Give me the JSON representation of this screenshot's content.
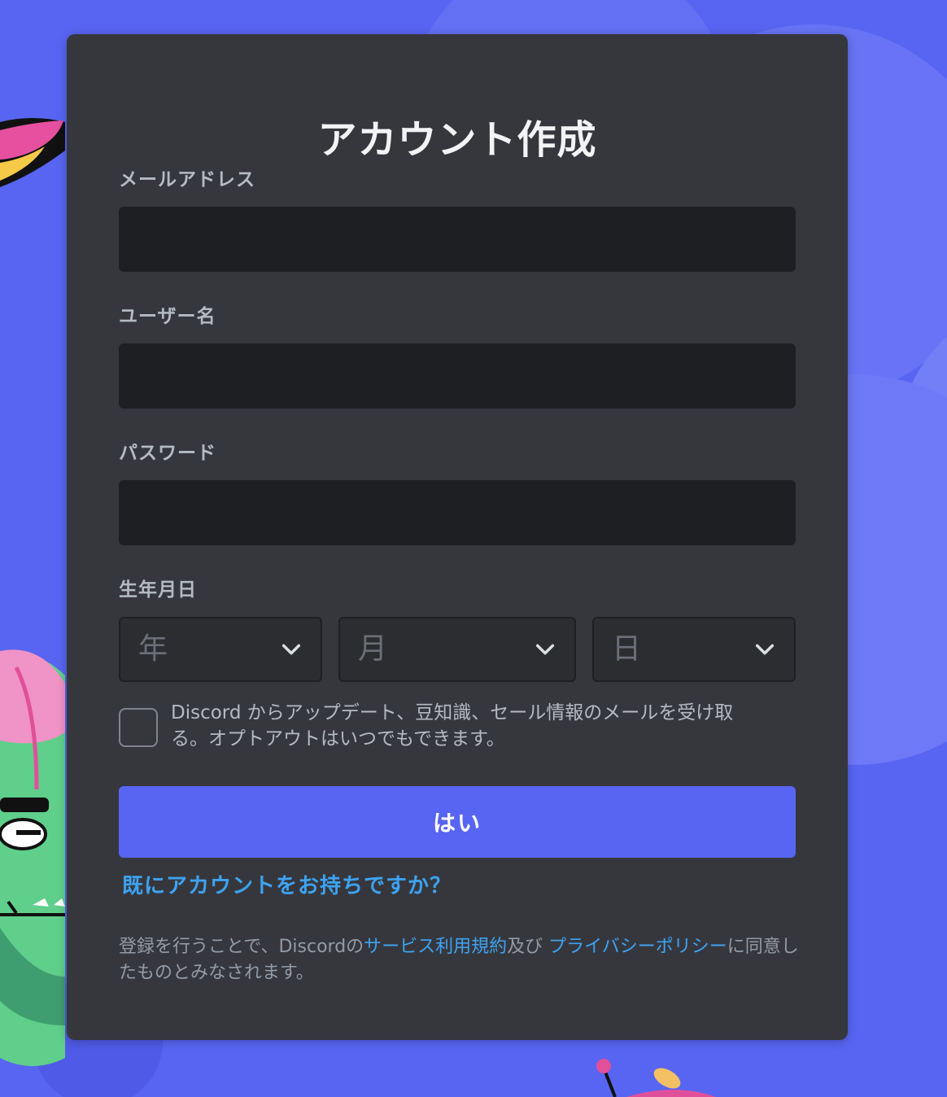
{
  "form": {
    "title": "アカウント作成",
    "email_label": "メールアドレス",
    "email_value": "",
    "username_label": "ユーザー名",
    "username_value": "",
    "password_label": "パスワード",
    "password_value": "",
    "dob_label": "生年月日",
    "dob": {
      "year_placeholder": "年",
      "month_placeholder": "月",
      "day_placeholder": "日"
    },
    "optin_text": "Discord からアップデート、豆知識、セール情報のメールを受け取る。オプトアウトはいつでもできます。",
    "optin_checked": false,
    "submit_label": "はい",
    "login_link": "既にアカウントをお持ちですか？",
    "legal": {
      "prefix": "登録を行うことで、Discordの",
      "terms_link": "サービス利用規約",
      "middle": "及び ",
      "privacy_link": "プライバシーポリシー",
      "suffix": "に同意したものとみなされます。"
    }
  },
  "colors": {
    "background": "#5865f2",
    "card": "#36373d",
    "input": "#1e1f22",
    "button": "#5865f2",
    "link": "#3da3f2"
  },
  "icons": {
    "select_chevron": "chevron-down-icon"
  }
}
